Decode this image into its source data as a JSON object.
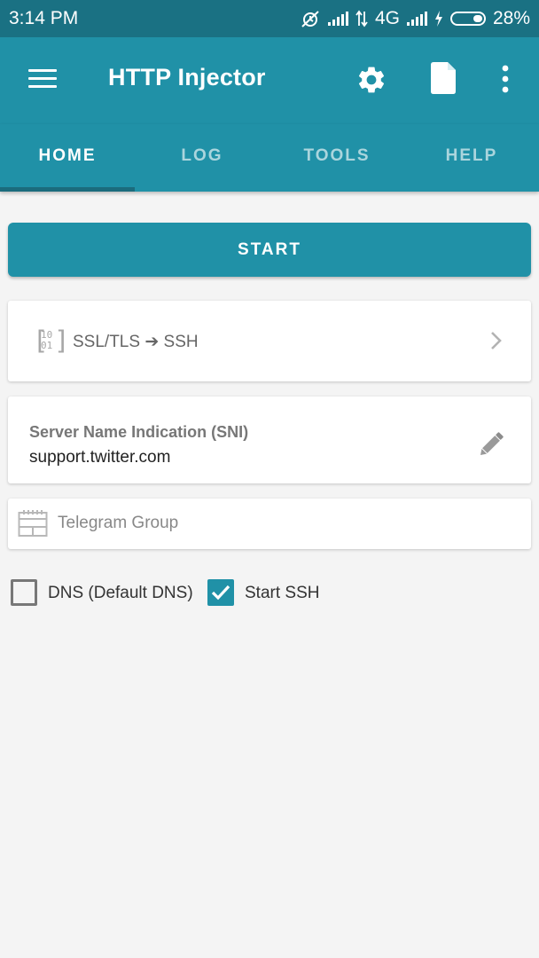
{
  "status_bar": {
    "time": "3:14 PM",
    "network": "4G",
    "battery": "28%",
    "icons": [
      "alarm-off-icon",
      "signal-icon",
      "data-transfer-icon",
      "signal-icon",
      "charging-icon",
      "battery-icon"
    ]
  },
  "app_bar": {
    "title": "HTTP Injector",
    "icons": [
      "menu-icon",
      "settings-icon",
      "file-icon",
      "more-options-icon"
    ]
  },
  "tabs": [
    {
      "label": "HOME",
      "active": true
    },
    {
      "label": "LOG",
      "active": false
    },
    {
      "label": "TOOLS",
      "active": false
    },
    {
      "label": "HELP",
      "active": false
    }
  ],
  "start_button": {
    "label": "START"
  },
  "tunnel": {
    "mode": "SSL/TLS ➔ SSH",
    "icon": "binary-brackets-icon",
    "icon_bits": [
      "10",
      "01"
    ]
  },
  "sni": {
    "title": "Server Name Indication (SNI)",
    "value": "support.twitter.com"
  },
  "telegram": {
    "placeholder": "Telegram Group"
  },
  "options": {
    "dns": {
      "label": "DNS (Default DNS)",
      "checked": false
    },
    "ssh": {
      "label": "Start SSH",
      "checked": true
    }
  },
  "colors": {
    "primary": "#2091a7",
    "status_bar": "#1a7183",
    "background": "#f4f4f4"
  }
}
